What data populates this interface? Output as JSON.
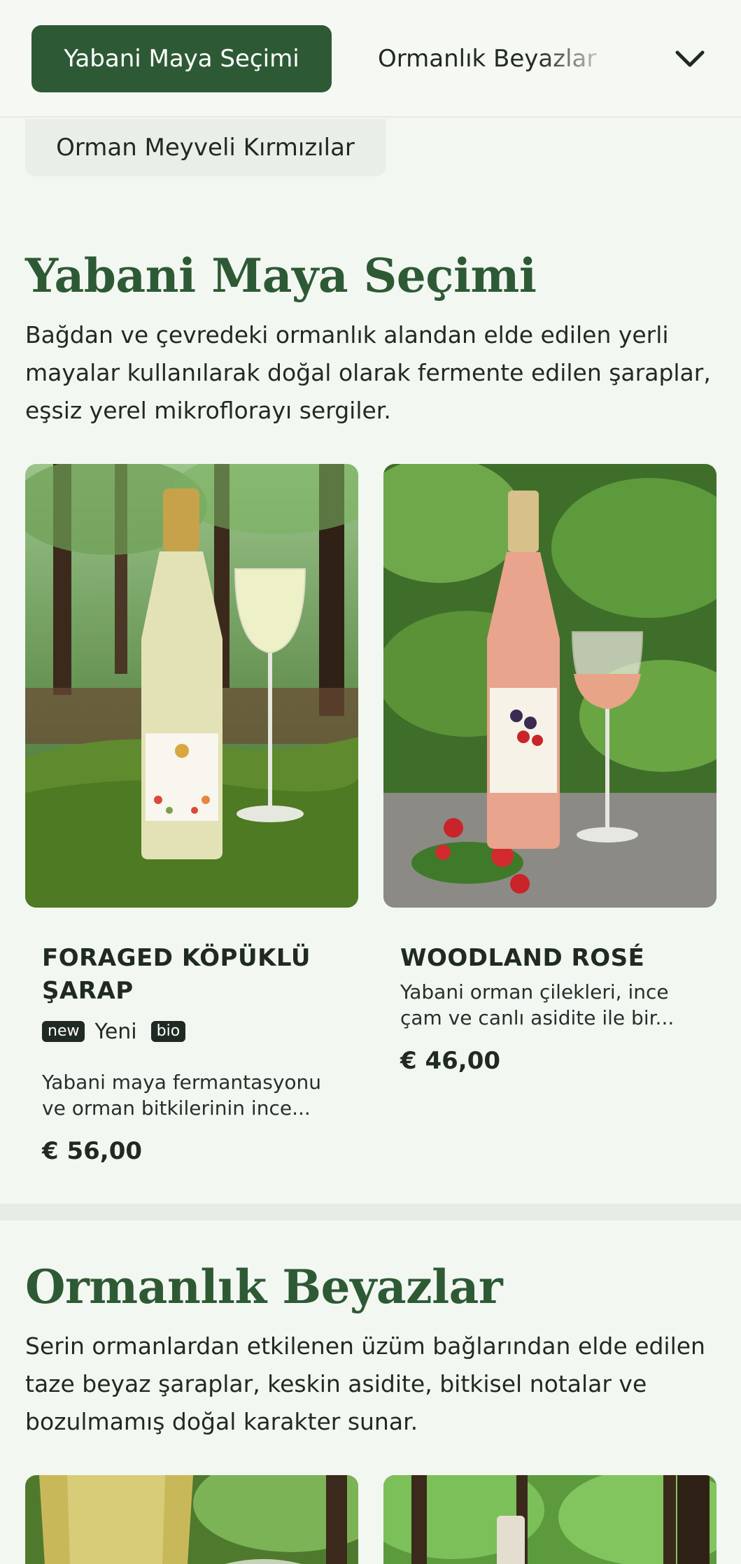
{
  "nav": {
    "active_tab": "Yabani Maya Seçimi",
    "next_tab": "Ormanlık Beyazlar",
    "secondary_tab": "Orman Meyveli Kırmızılar",
    "expand_icon": "chevron-down-icon"
  },
  "section1": {
    "title": "Yabani Maya Seçimi",
    "description": "Bağdan ve çevredeki ormanlık alandan elde edilen yerli mayalar kullanılarak doğal olarak fermente edilen şaraplar, eşsiz yerel mikroflorayı sergiler.",
    "products": [
      {
        "name": "FORAGED KÖPÜKLÜ ŞARAP",
        "badge_new": "new",
        "badge_new_label": "Yeni",
        "badge_bio": "bio",
        "description": "Yabani maya fermantasyonu ve orman bitkilerinin ince...",
        "price": "€ 56,00"
      },
      {
        "name": "WOODLAND ROSÉ",
        "description": "Yabani orman çilekleri, ince çam ve canlı asidite ile bir...",
        "price": "€ 46,00"
      }
    ]
  },
  "section2": {
    "title": "Ormanlık Beyazlar",
    "description": "Serin ormanlardan etkilenen üzüm bağlarından elde edilen taze beyaz şaraplar, keskin asidite, bitkisel notalar ve bozulmamış doğal karakter sunar."
  },
  "colors": {
    "brand_green": "#2d5a35",
    "background": "#f3f7f1",
    "text": "#1f2a22"
  }
}
